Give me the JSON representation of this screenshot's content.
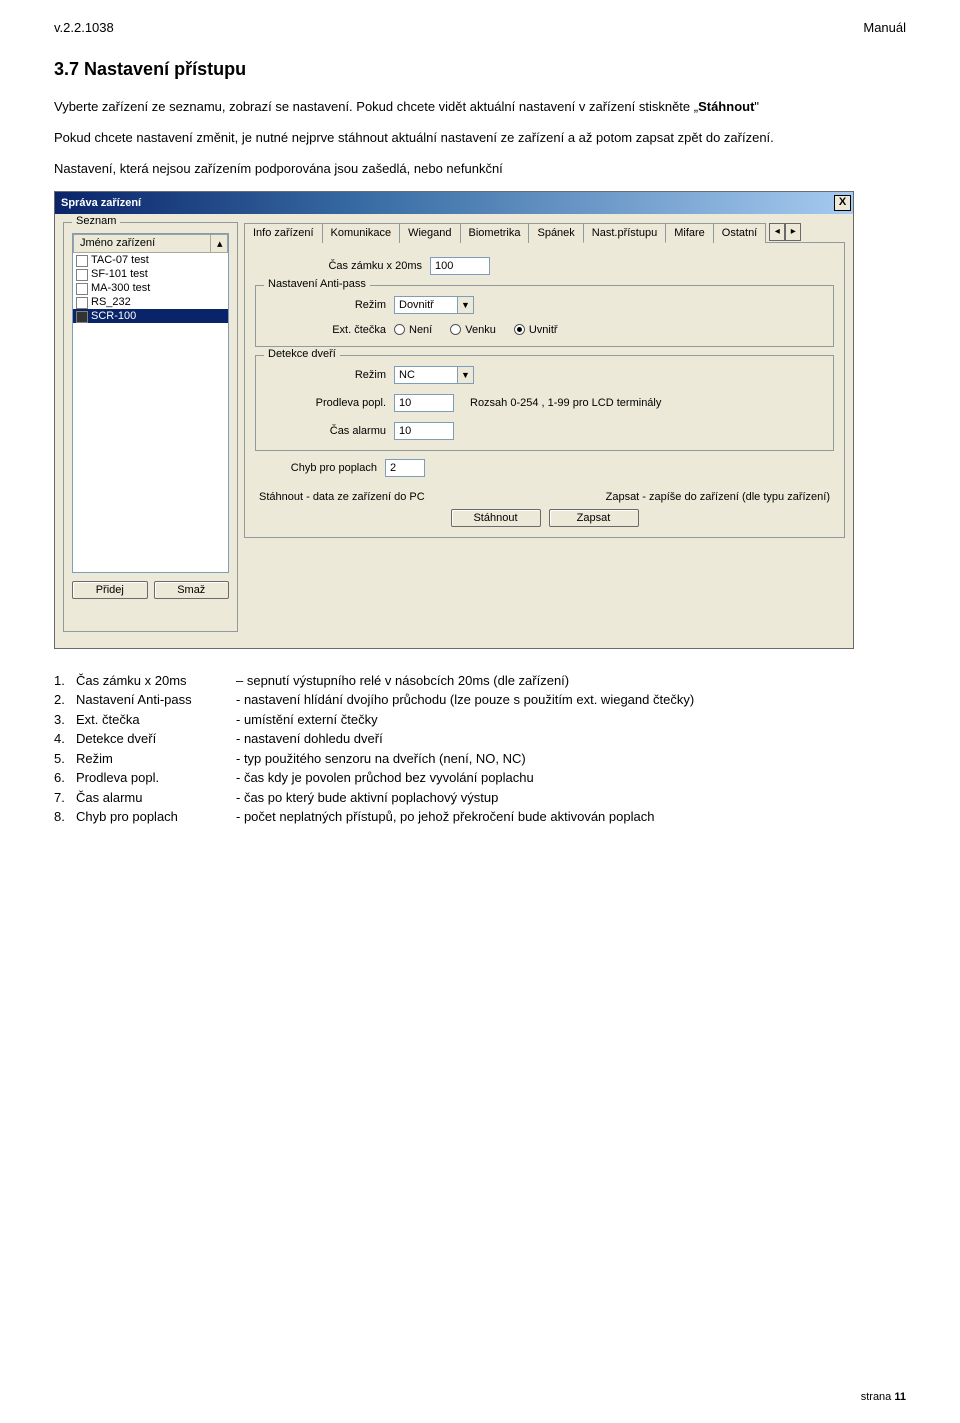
{
  "doc": {
    "version": "v.2.2.1038",
    "doc_type": "Manuál",
    "section_title": "3.7 Nastavení přístupu",
    "para1": "Vyberte zařízení ze seznamu, zobrazí se nastavení. Pokud chcete vidět aktuální nastavení v zařízení stiskněte „Stáhnout\"",
    "para2": "Pokud chcete nastavení změnit, je nutné nejprve stáhnout aktuální nastavení ze zařízení a až potom zapsat zpět do zařízení.",
    "para3": "Nastavení, která nejsou zařízením podporována jsou zašedlá, nebo nefunkční",
    "footer": "strana 11"
  },
  "window": {
    "title": "Správa zařízení",
    "close": "X",
    "seznam_label": "Seznam",
    "list_header": "Jméno zařízení",
    "scroll_up": "▴",
    "devices": [
      {
        "name": "TAC-07 test",
        "selected": false
      },
      {
        "name": "SF-101 test",
        "selected": false
      },
      {
        "name": "MA-300 test",
        "selected": false
      },
      {
        "name": "RS_232",
        "selected": false
      },
      {
        "name": "SCR-100",
        "selected": true
      }
    ],
    "btn_add": "Přidej",
    "btn_del": "Smaž",
    "tabs": [
      {
        "label": "Info zařízení",
        "active": false
      },
      {
        "label": "Komunikace",
        "active": false
      },
      {
        "label": "Wiegand",
        "active": false
      },
      {
        "label": "Biometrika",
        "active": false
      },
      {
        "label": "Spánek",
        "active": false
      },
      {
        "label": "Nast.přístupu",
        "active": true
      },
      {
        "label": "Mifare",
        "active": false
      },
      {
        "label": "Ostatní",
        "active": false
      }
    ],
    "arrows": {
      "left": "◂",
      "right": "▸"
    },
    "lock_time_label": "Čas zámku x 20ms",
    "lock_time_value": "100",
    "antipass_legend": "Nastavení Anti-pass",
    "antipass_mode_label": "Režim",
    "antipass_mode_value": "Dovnitř",
    "ext_reader_label": "Ext. čtečka",
    "ext_reader_options": [
      {
        "label": "Není",
        "checked": false
      },
      {
        "label": "Venku",
        "checked": false
      },
      {
        "label": "Uvnitř",
        "checked": true
      }
    ],
    "door_legend": "Detekce dveří",
    "door_mode_label": "Režim",
    "door_mode_value": "NC",
    "delay_label": "Prodleva popl.",
    "delay_value": "10",
    "delay_help": "Rozsah 0-254 , 1-99 pro LCD terminály",
    "alarm_label": "Čas alarmu",
    "alarm_value": "10",
    "fails_label": "Chyb pro poplach",
    "fails_value": "2",
    "hint_left": "Stáhnout - data ze zařízení do PC",
    "hint_right": "Zapsat - zapíše do zařízení (dle typu zařízení)",
    "btn_download": "Stáhnout",
    "btn_write": "Zapsat"
  },
  "definitions": [
    {
      "n": "1.",
      "term": "Čas zámku x 20ms",
      "desc": "– sepnutí výstupního relé v násobcích 20ms (dle zařízení)"
    },
    {
      "n": "2.",
      "term": "Nastavení Anti-pass",
      "desc": "- nastavení hlídání dvojího průchodu (lze pouze s použitím ext. wiegand čtečky)"
    },
    {
      "n": "3.",
      "term": "Ext. čtečka",
      "desc": "- umístění externí čtečky"
    },
    {
      "n": "4.",
      "term": "Detekce dveří",
      "desc": "- nastavení dohledu dveří"
    },
    {
      "n": "5.",
      "term": "Režim",
      "desc": "- typ použitého senzoru na dveřích (není, NO, NC)"
    },
    {
      "n": "6.",
      "term": "Prodleva popl.",
      "desc": "- čas kdy je povolen průchod bez vyvolání poplachu"
    },
    {
      "n": "7.",
      "term": "Čas alarmu",
      "desc": "- čas po který bude aktivní poplachový výstup"
    },
    {
      "n": "8.",
      "term": "Chyb pro poplach",
      "desc": "- počet neplatných přístupů, po jehož překročení bude aktivován poplach"
    }
  ]
}
